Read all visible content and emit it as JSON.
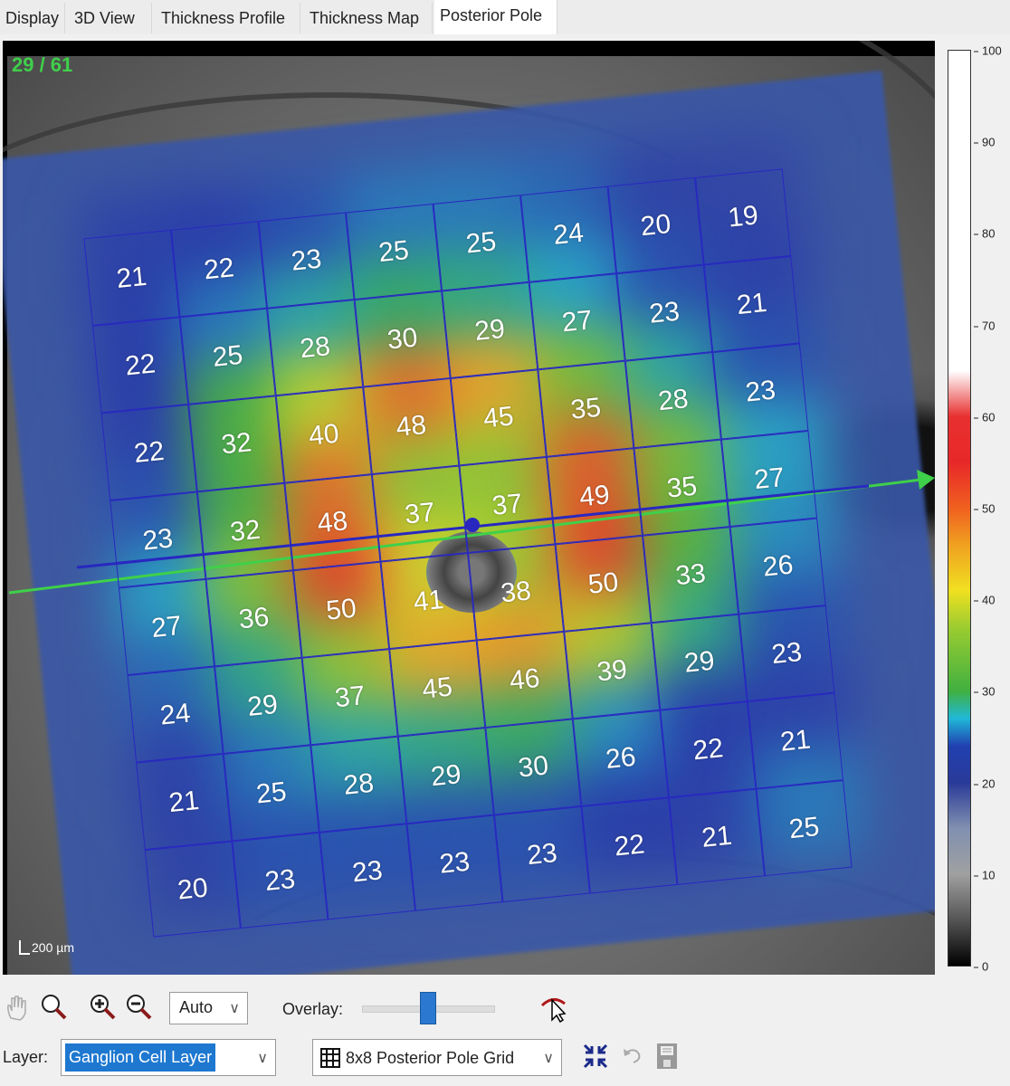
{
  "tabs": [
    {
      "label": "Display"
    },
    {
      "label": "3D View"
    },
    {
      "label": "Thickness Profile"
    },
    {
      "label": "Thickness Map"
    },
    {
      "label": "Posterior Pole",
      "active": true
    }
  ],
  "viewer": {
    "scan_counter": "29 / 61",
    "scale_label": "200 µm"
  },
  "grid": {
    "values": [
      [
        21,
        22,
        23,
        25,
        25,
        24,
        20,
        19
      ],
      [
        22,
        25,
        28,
        30,
        29,
        27,
        23,
        21
      ],
      [
        22,
        32,
        40,
        48,
        45,
        35,
        28,
        23
      ],
      [
        23,
        32,
        48,
        37,
        37,
        49,
        35,
        27
      ],
      [
        27,
        36,
        50,
        41,
        38,
        50,
        33,
        26
      ],
      [
        24,
        29,
        37,
        45,
        46,
        39,
        29,
        23
      ],
      [
        21,
        25,
        28,
        29,
        30,
        26,
        22,
        21
      ],
      [
        20,
        23,
        23,
        23,
        23,
        22,
        21,
        25
      ]
    ],
    "line_color": "#2828c0"
  },
  "colorbar": {
    "ticks": [
      "100",
      "90",
      "80",
      "70",
      "60",
      "50",
      "40",
      "30",
      "20",
      "10",
      "0"
    ],
    "min": 0,
    "max": 100
  },
  "toolbar": {
    "zoom_select": "Auto",
    "overlay_label": "Overlay:",
    "overlay_value": 0.5,
    "layer_label": "Layer:",
    "layer_value": "Ganglion Cell Layer",
    "grid_value": "8x8 Posterior Pole Grid"
  },
  "icons": [
    "hand-icon",
    "magnifier-icon",
    "zoom-in-icon",
    "zoom-out-icon",
    "overlay-cursor-icon",
    "grid-icon",
    "collapse-icon",
    "undo-icon",
    "save-icon"
  ],
  "colors": {
    "accent": "#1e78d0",
    "counter": "#3fd04a",
    "scan_line": "#3fd04a"
  }
}
